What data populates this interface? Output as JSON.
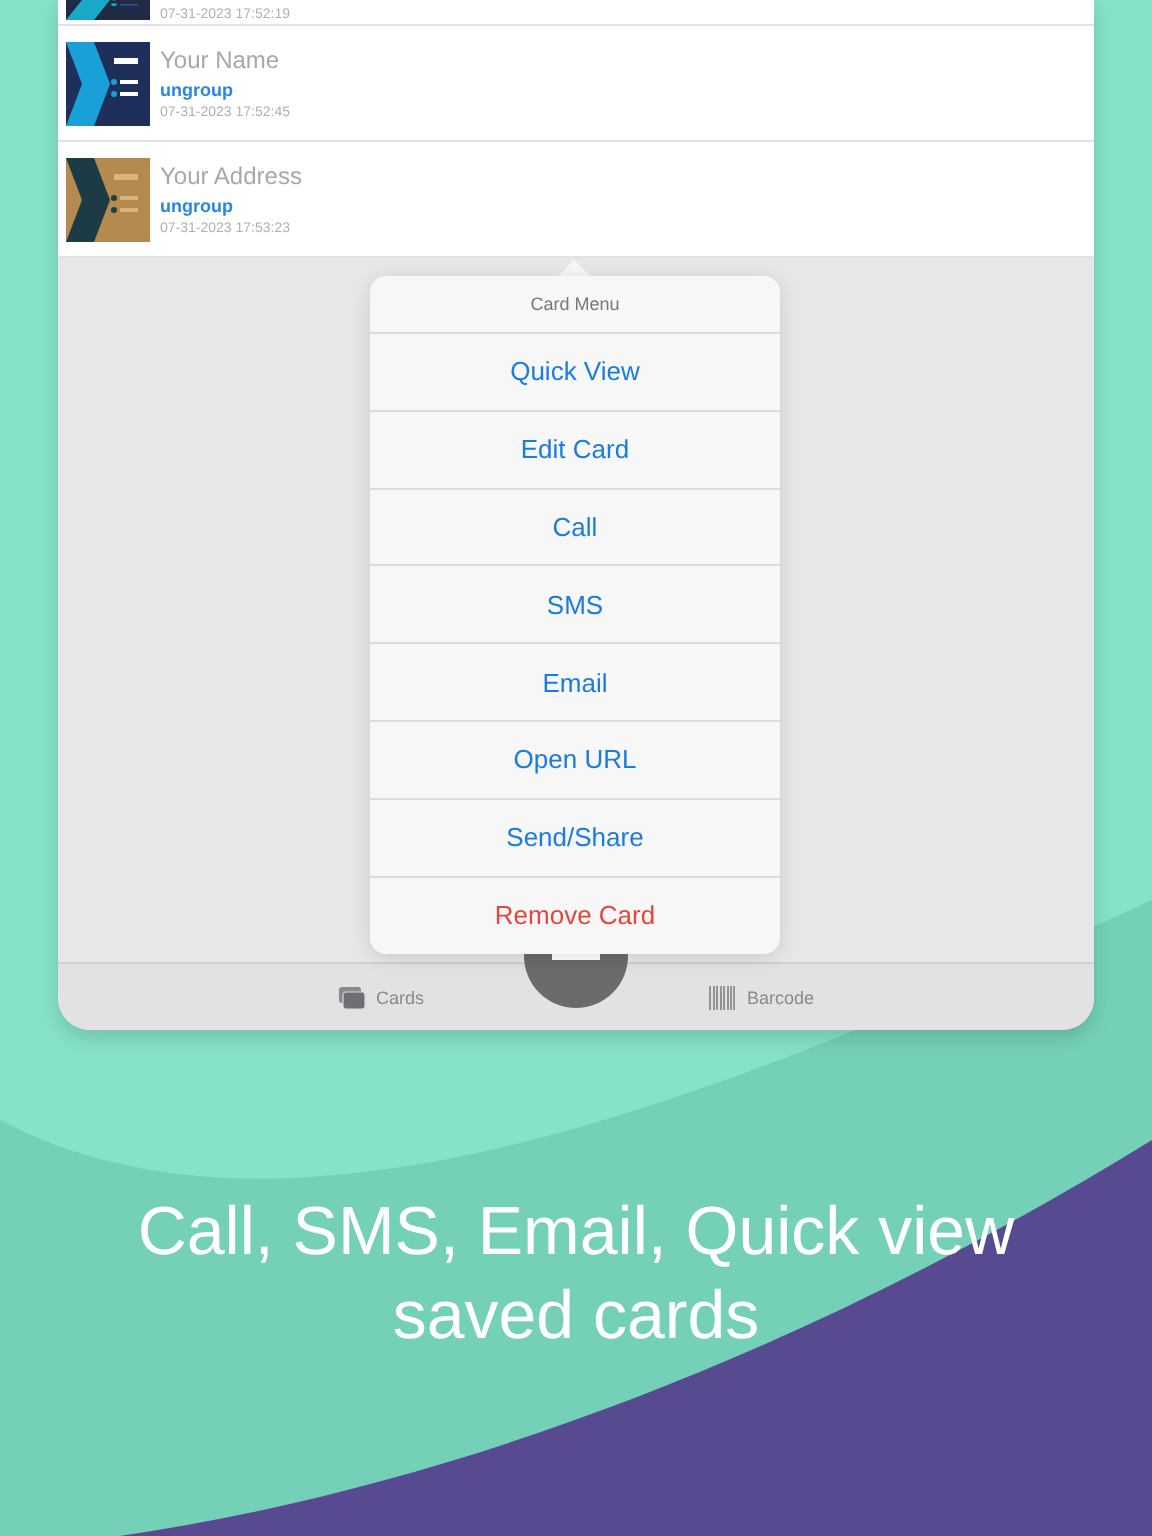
{
  "cards": [
    {
      "date": "07-31-2023 17:52:19",
      "kind": "picture"
    },
    {
      "name": "Your Name",
      "group": "ungroup",
      "date": "07-31-2023 17:52:45",
      "kind": "picture"
    },
    {
      "name": "Your Address",
      "group": "ungroup",
      "date": "07-31-2023 17:53:23",
      "kind": "picture"
    }
  ],
  "menu": {
    "title": "Card Menu",
    "items": [
      {
        "label": "Quick View",
        "kind": "action"
      },
      {
        "label": "Edit Card",
        "kind": "action"
      },
      {
        "label": "Call",
        "kind": "action"
      },
      {
        "label": "SMS",
        "kind": "action"
      },
      {
        "label": "Email",
        "kind": "action"
      },
      {
        "label": "Open URL",
        "kind": "action"
      },
      {
        "label": "Send/Share",
        "kind": "action"
      },
      {
        "label": "Remove Card",
        "kind": "destructive"
      }
    ]
  },
  "tab_bar": {
    "items": [
      {
        "label": "Cards",
        "kind": "cards"
      },
      {
        "label": "Barcode",
        "kind": "barcode"
      }
    ]
  },
  "headline": "Call, SMS, Email, Quick view saved cards"
}
